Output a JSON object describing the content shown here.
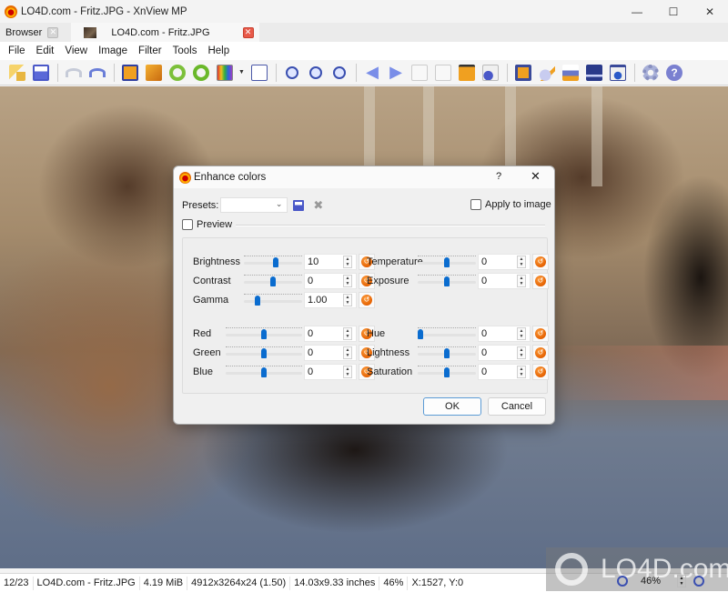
{
  "window": {
    "title": "LO4D.com - Fritz.JPG - XnView MP",
    "controls": {
      "minimize": "—",
      "maximize": "☐",
      "close": "✕"
    }
  },
  "tabs": [
    {
      "label": "Browser",
      "close": "✕",
      "active": false
    },
    {
      "label": "LO4D.com - Fritz.JPG",
      "close": "✕",
      "active": true
    }
  ],
  "menu": [
    "File",
    "Edit",
    "View",
    "Image",
    "Filter",
    "Tools",
    "Help"
  ],
  "toolbar": {
    "groups": [
      [
        "browse-folders-icon",
        "save-as-icon"
      ],
      [
        "undo-icon",
        "redo-icon"
      ],
      [
        "crop-icon",
        "resize-icon",
        "rotate-left-icon",
        "rotate-right-icon",
        "adjust-colors-icon",
        "levels-icon"
      ],
      [
        "zoom-in-icon",
        "zoom-actual-icon",
        "zoom-out-icon"
      ],
      [
        "previous-icon",
        "next-icon",
        "previous-page-icon",
        "next-page-icon",
        "slideshow-icon",
        "properties-icon"
      ],
      [
        "fullscreen-icon",
        "edit-text-icon",
        "print-icon",
        "scan-icon",
        "capture-icon"
      ],
      [
        "settings-icon",
        "help-icon"
      ]
    ],
    "colors": {
      "accent_blue": "#4a58c8",
      "accent_orange": "#f09a18",
      "green": "#6ab82a"
    }
  },
  "dialog": {
    "title": "Enhance colors",
    "help": "?",
    "close": "✕",
    "presets_label": "Presets:",
    "presets_value": "",
    "apply_to_image_label": "Apply to image",
    "apply_to_image_checked": false,
    "preview_label": "Preview",
    "preview_checked": false,
    "controls_left_top": [
      {
        "label": "Brightness",
        "value": "10",
        "slider_pos": 0.55
      },
      {
        "label": "Contrast",
        "value": "0",
        "slider_pos": 0.5
      },
      {
        "label": "Gamma",
        "value": "1.00",
        "slider_pos": 0.2
      }
    ],
    "controls_right_top": [
      {
        "label": "Temperature",
        "value": "0",
        "slider_pos": 0.5
      },
      {
        "label": "Exposure",
        "value": "0",
        "slider_pos": 0.5
      }
    ],
    "controls_left_bottom": [
      {
        "label": "Red",
        "value": "0",
        "slider_pos": 0.5
      },
      {
        "label": "Green",
        "value": "0",
        "slider_pos": 0.5
      },
      {
        "label": "Blue",
        "value": "0",
        "slider_pos": 0.5
      }
    ],
    "controls_right_bottom": [
      {
        "label": "Hue",
        "value": "0",
        "slider_pos": 0.0
      },
      {
        "label": "Lightness",
        "value": "0",
        "slider_pos": 0.5
      },
      {
        "label": "Saturation",
        "value": "0",
        "slider_pos": 0.5
      }
    ],
    "ok_label": "OK",
    "cancel_label": "Cancel",
    "slider_color": "#0a6ccf",
    "reset_color": "#e46000"
  },
  "statusbar": {
    "position": "12/23",
    "filename": "LO4D.com - Fritz.JPG",
    "filesize": "4.19 MiB",
    "dimensions": "4912x3264x24 (1.50)",
    "print_size": "14.03x9.33 inches",
    "zoom": "46%",
    "coords": "X:1527, Y:0"
  },
  "zoom_control": {
    "value": "46%"
  },
  "watermark": "LO4D.com"
}
